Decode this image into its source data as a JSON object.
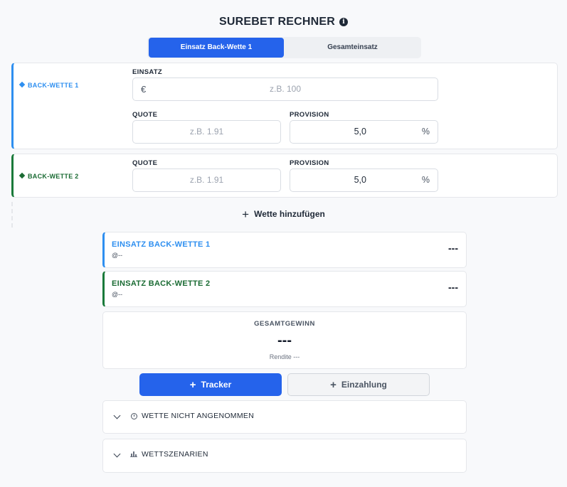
{
  "header": {
    "title": "SUREBET RECHNER",
    "info_glyph": "i"
  },
  "mode_tabs": {
    "active": "Einsatz Back-Wette 1",
    "inactive": "Gesamteinsatz"
  },
  "bet1": {
    "label": "BACK-WETTE 1",
    "stake_label": "EINSATZ",
    "stake_prefix": "€",
    "stake_placeholder": "z.B. 100",
    "odds_label": "QUOTE",
    "odds_placeholder": "z.B. 1.91",
    "commission_label": "PROVISION",
    "commission_value": "5,0",
    "commission_suffix": "%"
  },
  "bet2": {
    "label": "BACK-WETTE 2",
    "odds_label": "QUOTE",
    "odds_placeholder": "z.B. 1.91",
    "commission_label": "PROVISION",
    "commission_value": "5,0",
    "commission_suffix": "%"
  },
  "add_bet": {
    "label": "Wette hinzufügen",
    "icon": "+"
  },
  "results": [
    {
      "title": "EINSATZ BACK-WETTE 1",
      "sub": "@--",
      "value": "---"
    },
    {
      "title": "EINSATZ BACK-WETTE 2",
      "sub": "@--",
      "value": "---"
    }
  ],
  "total": {
    "title": "GESAMTGEWINN",
    "value": "---",
    "sub": "Rendite ---"
  },
  "actions": {
    "tracker": "Tracker",
    "deposit": "Einzahlung",
    "icon": "+"
  },
  "accordions": [
    {
      "title": "WETTE NICHT ANGENOMMEN",
      "icon": "clock-icon"
    },
    {
      "title": "WETTSZENARIEN",
      "icon": "bar-chart-icon",
      "glyph": "📊"
    }
  ],
  "colors": {
    "accent": "#2563eb",
    "bet1": "#2e8ff0",
    "bet2": "#1a6b33"
  }
}
